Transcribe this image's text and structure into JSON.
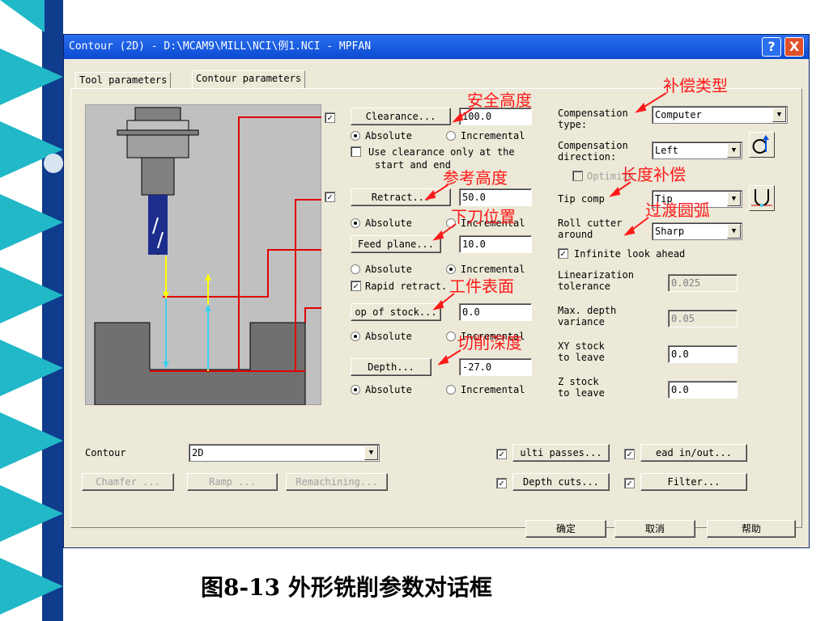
{
  "window": {
    "title": "Contour (2D) - D:\\MCAM9\\MILL\\NCI\\例1.NCI - MPFAN",
    "help_label": "?",
    "close_label": "X"
  },
  "tabs": [
    {
      "label": "Tool parameters"
    },
    {
      "label": "Contour parameters"
    }
  ],
  "clearance": {
    "label": "Clearance...",
    "value": "100.0",
    "checked": "✓",
    "abs": "Absolute",
    "inc": "Incremental",
    "use_only_line1": "Use clearance only at the",
    "use_only_line2": "start and end"
  },
  "retract": {
    "label": "Retract...",
    "value": "50.0",
    "checked": "✓",
    "abs": "Absolute",
    "inc": "Incremental"
  },
  "feed": {
    "label": "Feed plane...",
    "value": "10.0",
    "abs": "Absolute",
    "inc": "Incremental",
    "rapid": "Rapid retract.",
    "rapid_checked": "✓"
  },
  "stock": {
    "label": "op of stock...",
    "value": "0.0",
    "abs": "Absolute",
    "inc": "Incremental"
  },
  "depth": {
    "label": "Depth...",
    "value": "-27.0",
    "abs": "Absolute",
    "inc": "Incremental"
  },
  "comp": {
    "type_line1": "Compensation",
    "type_line2": "type:",
    "type_value": "Computer",
    "dir_line1": "Compensation",
    "dir_line2": "direction:",
    "dir_value": "Left",
    "optimize": "Optimize",
    "tip_label": "Tip comp",
    "tip_value": "Tip",
    "roll_line1": "Roll cutter",
    "roll_line2": "around",
    "roll_value": "Sharp",
    "infinite": "Infinite look ahead",
    "infinite_checked": "✓",
    "lin_line1": "Linearization",
    "lin_line2": "tolerance",
    "lin_value": "0.025",
    "maxd_line1": "Max. depth",
    "maxd_line2": "variance",
    "maxd_value": "0.05",
    "xy_line1": "XY stock",
    "xy_line2": "to leave",
    "xy_value": "0.0",
    "z_line1": "Z stock",
    "z_line2": "to leave",
    "z_value": "0.0"
  },
  "contour": {
    "label": "Contour",
    "value": "2D"
  },
  "bottom_buttons": {
    "chamfer": "Chamfer ...",
    "ramp": "Ramp ...",
    "remachining": "Remachining...",
    "multi": "ulti passes...",
    "depth_cuts": "Depth cuts...",
    "lead": "ead in/out...",
    "filter": "Filter...",
    "check": "✓"
  },
  "footer": {
    "ok": "确定",
    "cancel": "取消",
    "help": "帮助"
  },
  "annotations": {
    "safe_height": "安全高度",
    "ref_height": "参考高度",
    "feed_pos": "下刀位置",
    "stock_top": "工件表面",
    "cut_depth": "切削深度",
    "comp_type": "补偿类型",
    "length_comp": "长度补偿",
    "fillet": "过渡圆弧"
  },
  "caption": "图8-13 外形铣削参数对话框",
  "colors": {
    "annotation": "#ff1a1a",
    "titlebar": "#0a4ad2",
    "deco_cyan": "#21b8c8",
    "deco_navy": "#0f3c8c"
  }
}
